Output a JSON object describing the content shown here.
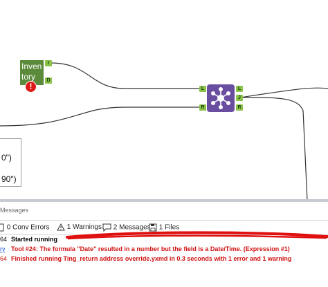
{
  "workflow": {
    "input_tool": {
      "label_line1": "Inven",
      "label_line2": "tory",
      "anchor_top": "I",
      "anchor_bottom": "D"
    },
    "error_icon": "!",
    "join_tool": {
      "anchor_left_top": "L",
      "anchor_left_bottom": "R",
      "anchor_right_1": "L",
      "anchor_right_2": "J",
      "anchor_right_3": "R"
    },
    "formula_box": {
      "line1": "0\")",
      "line2": "90\")"
    }
  },
  "messages_panel": {
    "title": "Messages",
    "toolbar": {
      "conv_errors": "0 Conv Errors",
      "warnings": "1 Warnings",
      "messages": "2 Messages",
      "files": "1 Files"
    },
    "rows": [
      {
        "id": "64",
        "text": "Started running",
        "type": "info"
      },
      {
        "id": "ry",
        "text": "Tool #24: The formula \"Date\" resulted in a number but the field is a Date/Time. (Expression #1)",
        "type": "error"
      },
      {
        "id": "64",
        "text": "Finished running Ting_return address override.yxmd in 0.3 seconds with 1 error and 1 warning",
        "type": "error"
      }
    ]
  },
  "colors": {
    "input_tool": "#5a8a3a",
    "join_tool": "#6a4fa0",
    "anchor": "#8bc34a",
    "error_text": "#d01010",
    "redaction": "#e01010"
  }
}
